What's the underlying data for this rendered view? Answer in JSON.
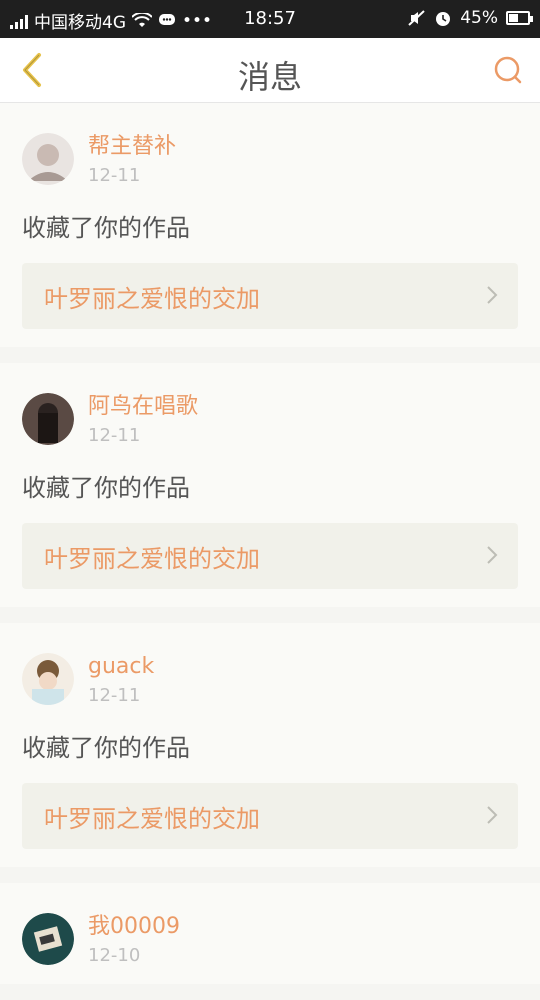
{
  "status_bar": {
    "carrier": "中国移动4G",
    "time": "18:57",
    "battery": "45%",
    "battery_level": 0.45
  },
  "nav": {
    "title": "消息",
    "back_icon": "chevron-left-icon",
    "search_icon": "search-icon"
  },
  "colors": {
    "accent": "#eb9a66",
    "nav_icon": "#e7c24a"
  },
  "messages": [
    {
      "user": "帮主替补",
      "date": "12-11",
      "action": "收藏了你的作品",
      "work_title": "叶罗丽之爱恨的交加"
    },
    {
      "user": "阿鸟在唱歌",
      "date": "12-11",
      "action": "收藏了你的作品",
      "work_title": "叶罗丽之爱恨的交加"
    },
    {
      "user": "guack",
      "date": "12-11",
      "action": "收藏了你的作品",
      "work_title": "叶罗丽之爱恨的交加"
    },
    {
      "user": "我00009",
      "date": "12-10",
      "action": "",
      "work_title": ""
    }
  ]
}
